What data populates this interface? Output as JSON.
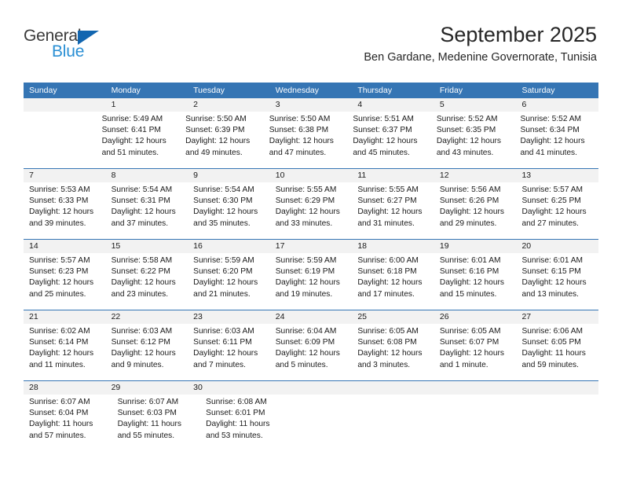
{
  "logo": {
    "text_top": "General",
    "text_bottom": "Blue",
    "triangle_icon": "triangle-icon",
    "color_dark": "#3b3b3b",
    "color_blue": "#2a8fd4",
    "color_triangle": "#1266b0"
  },
  "header": {
    "month_title": "September 2025",
    "location": "Ben Gardane, Medenine Governorate, Tunisia"
  },
  "theme": {
    "header_blue": "#3575b4",
    "date_band": "#f2f2f2",
    "text": "#1a1a1a"
  },
  "weekdays": [
    "Sunday",
    "Monday",
    "Tuesday",
    "Wednesday",
    "Thursday",
    "Friday",
    "Saturday"
  ],
  "weeks": [
    {
      "days": [
        {
          "date": "",
          "lines": []
        },
        {
          "date": "1",
          "lines": [
            "Sunrise: 5:49 AM",
            "Sunset: 6:41 PM",
            "Daylight: 12 hours",
            "and 51 minutes."
          ]
        },
        {
          "date": "2",
          "lines": [
            "Sunrise: 5:50 AM",
            "Sunset: 6:39 PM",
            "Daylight: 12 hours",
            "and 49 minutes."
          ]
        },
        {
          "date": "3",
          "lines": [
            "Sunrise: 5:50 AM",
            "Sunset: 6:38 PM",
            "Daylight: 12 hours",
            "and 47 minutes."
          ]
        },
        {
          "date": "4",
          "lines": [
            "Sunrise: 5:51 AM",
            "Sunset: 6:37 PM",
            "Daylight: 12 hours",
            "and 45 minutes."
          ]
        },
        {
          "date": "5",
          "lines": [
            "Sunrise: 5:52 AM",
            "Sunset: 6:35 PM",
            "Daylight: 12 hours",
            "and 43 minutes."
          ]
        },
        {
          "date": "6",
          "lines": [
            "Sunrise: 5:52 AM",
            "Sunset: 6:34 PM",
            "Daylight: 12 hours",
            "and 41 minutes."
          ]
        }
      ]
    },
    {
      "days": [
        {
          "date": "7",
          "lines": [
            "Sunrise: 5:53 AM",
            "Sunset: 6:33 PM",
            "Daylight: 12 hours",
            "and 39 minutes."
          ]
        },
        {
          "date": "8",
          "lines": [
            "Sunrise: 5:54 AM",
            "Sunset: 6:31 PM",
            "Daylight: 12 hours",
            "and 37 minutes."
          ]
        },
        {
          "date": "9",
          "lines": [
            "Sunrise: 5:54 AM",
            "Sunset: 6:30 PM",
            "Daylight: 12 hours",
            "and 35 minutes."
          ]
        },
        {
          "date": "10",
          "lines": [
            "Sunrise: 5:55 AM",
            "Sunset: 6:29 PM",
            "Daylight: 12 hours",
            "and 33 minutes."
          ]
        },
        {
          "date": "11",
          "lines": [
            "Sunrise: 5:55 AM",
            "Sunset: 6:27 PM",
            "Daylight: 12 hours",
            "and 31 minutes."
          ]
        },
        {
          "date": "12",
          "lines": [
            "Sunrise: 5:56 AM",
            "Sunset: 6:26 PM",
            "Daylight: 12 hours",
            "and 29 minutes."
          ]
        },
        {
          "date": "13",
          "lines": [
            "Sunrise: 5:57 AM",
            "Sunset: 6:25 PM",
            "Daylight: 12 hours",
            "and 27 minutes."
          ]
        }
      ]
    },
    {
      "days": [
        {
          "date": "14",
          "lines": [
            "Sunrise: 5:57 AM",
            "Sunset: 6:23 PM",
            "Daylight: 12 hours",
            "and 25 minutes."
          ]
        },
        {
          "date": "15",
          "lines": [
            "Sunrise: 5:58 AM",
            "Sunset: 6:22 PM",
            "Daylight: 12 hours",
            "and 23 minutes."
          ]
        },
        {
          "date": "16",
          "lines": [
            "Sunrise: 5:59 AM",
            "Sunset: 6:20 PM",
            "Daylight: 12 hours",
            "and 21 minutes."
          ]
        },
        {
          "date": "17",
          "lines": [
            "Sunrise: 5:59 AM",
            "Sunset: 6:19 PM",
            "Daylight: 12 hours",
            "and 19 minutes."
          ]
        },
        {
          "date": "18",
          "lines": [
            "Sunrise: 6:00 AM",
            "Sunset: 6:18 PM",
            "Daylight: 12 hours",
            "and 17 minutes."
          ]
        },
        {
          "date": "19",
          "lines": [
            "Sunrise: 6:01 AM",
            "Sunset: 6:16 PM",
            "Daylight: 12 hours",
            "and 15 minutes."
          ]
        },
        {
          "date": "20",
          "lines": [
            "Sunrise: 6:01 AM",
            "Sunset: 6:15 PM",
            "Daylight: 12 hours",
            "and 13 minutes."
          ]
        }
      ]
    },
    {
      "days": [
        {
          "date": "21",
          "lines": [
            "Sunrise: 6:02 AM",
            "Sunset: 6:14 PM",
            "Daylight: 12 hours",
            "and 11 minutes."
          ]
        },
        {
          "date": "22",
          "lines": [
            "Sunrise: 6:03 AM",
            "Sunset: 6:12 PM",
            "Daylight: 12 hours",
            "and 9 minutes."
          ]
        },
        {
          "date": "23",
          "lines": [
            "Sunrise: 6:03 AM",
            "Sunset: 6:11 PM",
            "Daylight: 12 hours",
            "and 7 minutes."
          ]
        },
        {
          "date": "24",
          "lines": [
            "Sunrise: 6:04 AM",
            "Sunset: 6:09 PM",
            "Daylight: 12 hours",
            "and 5 minutes."
          ]
        },
        {
          "date": "25",
          "lines": [
            "Sunrise: 6:05 AM",
            "Sunset: 6:08 PM",
            "Daylight: 12 hours",
            "and 3 minutes."
          ]
        },
        {
          "date": "26",
          "lines": [
            "Sunrise: 6:05 AM",
            "Sunset: 6:07 PM",
            "Daylight: 12 hours",
            "and 1 minute."
          ]
        },
        {
          "date": "27",
          "lines": [
            "Sunrise: 6:06 AM",
            "Sunset: 6:05 PM",
            "Daylight: 11 hours",
            "and 59 minutes."
          ]
        }
      ]
    },
    {
      "days": [
        {
          "date": "28",
          "lines": [
            "Sunrise: 6:07 AM",
            "Sunset: 6:04 PM",
            "Daylight: 11 hours",
            "and 57 minutes."
          ]
        },
        {
          "date": "29",
          "lines": [
            "Sunrise: 6:07 AM",
            "Sunset: 6:03 PM",
            "Daylight: 11 hours",
            "and 55 minutes."
          ]
        },
        {
          "date": "30",
          "lines": [
            "Sunrise: 6:08 AM",
            "Sunset: 6:01 PM",
            "Daylight: 11 hours",
            "and 53 minutes."
          ]
        },
        {
          "date": "",
          "lines": []
        },
        {
          "date": "",
          "lines": []
        },
        {
          "date": "",
          "lines": []
        },
        {
          "date": "",
          "lines": []
        }
      ]
    }
  ]
}
